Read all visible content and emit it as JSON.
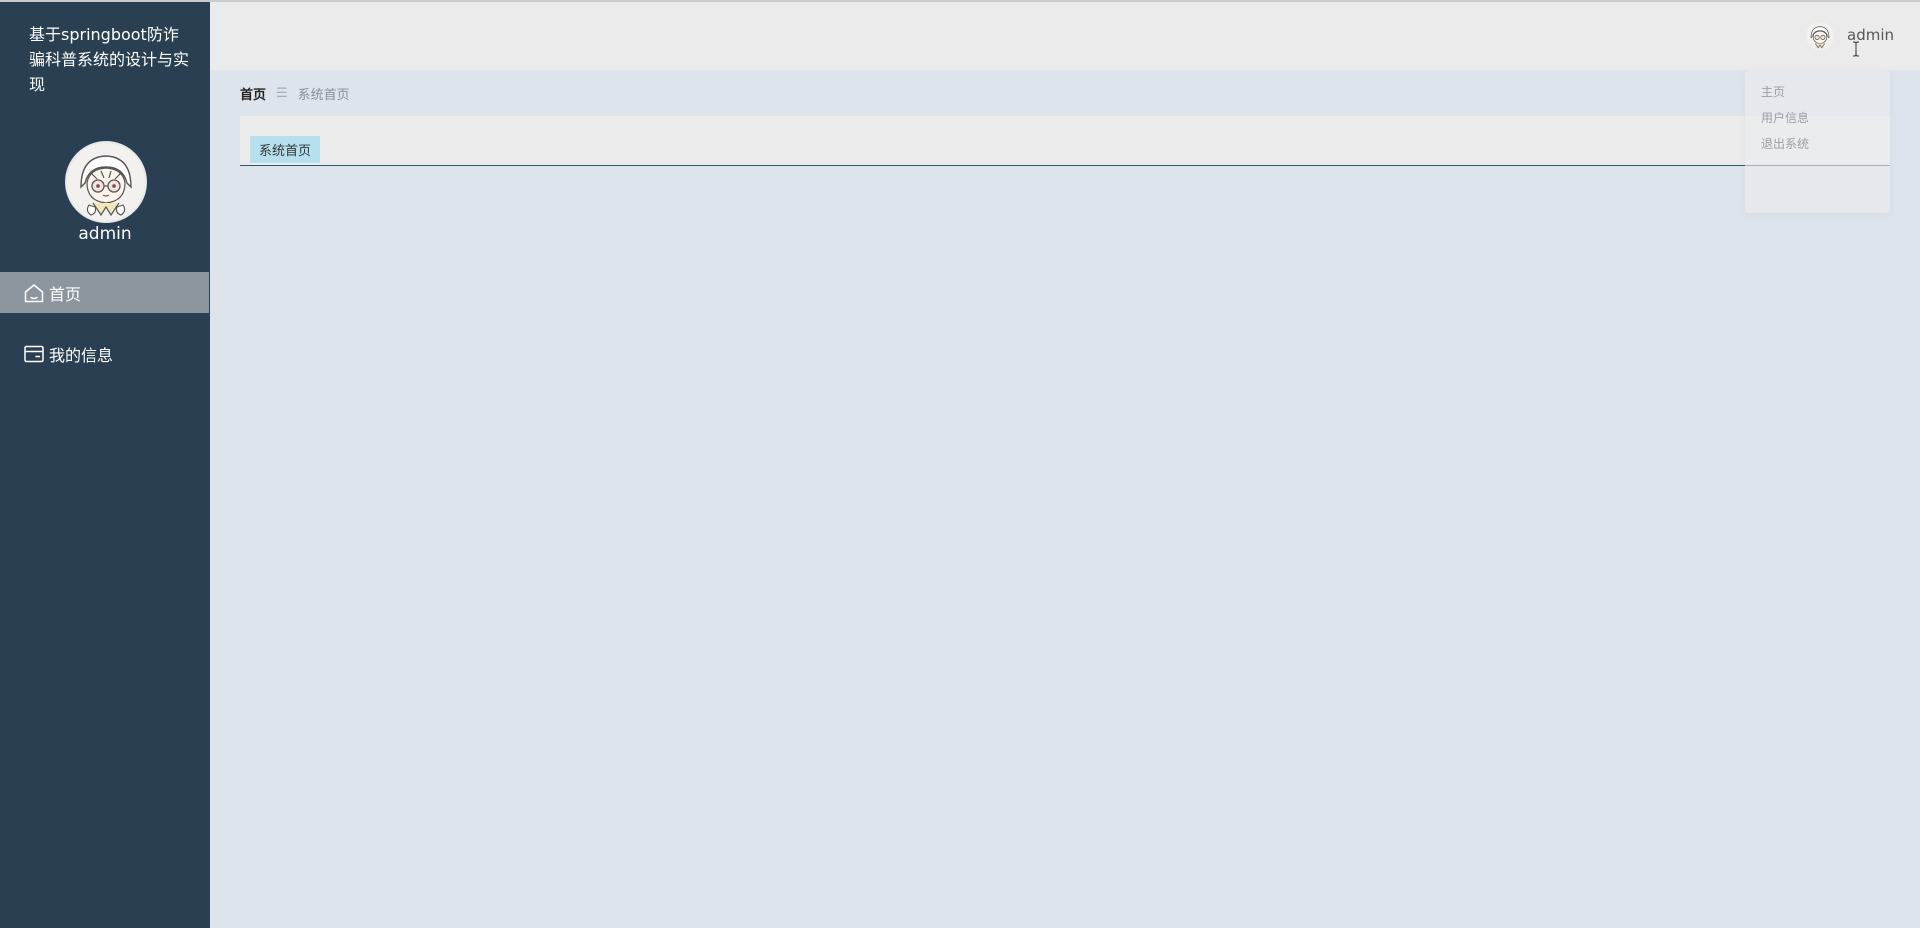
{
  "app": {
    "title": "基于springboot防诈骗科普系统的设计与实现"
  },
  "sidebar": {
    "username": "admin",
    "items": [
      {
        "label": "首页",
        "icon": "home-icon",
        "active": true
      },
      {
        "label": "我的信息",
        "icon": "card-icon",
        "active": false
      }
    ]
  },
  "header": {
    "username": "admin"
  },
  "breadcrumb": {
    "home": "首页",
    "separator": "☰",
    "current": "系统首页"
  },
  "tabs": [
    {
      "label": "系统首页",
      "active": true
    }
  ],
  "dropdown": {
    "items": [
      "主页",
      "用户信息",
      "退出系统"
    ]
  },
  "colors": {
    "sidebar_bg": "#2a4052",
    "sidebar_active": "#8d969e",
    "header_bg": "#ebebeb",
    "content_bg": "#dde4ec",
    "tab_active_bg": "#b6e0ee",
    "tabs_border": "#2f5470"
  }
}
